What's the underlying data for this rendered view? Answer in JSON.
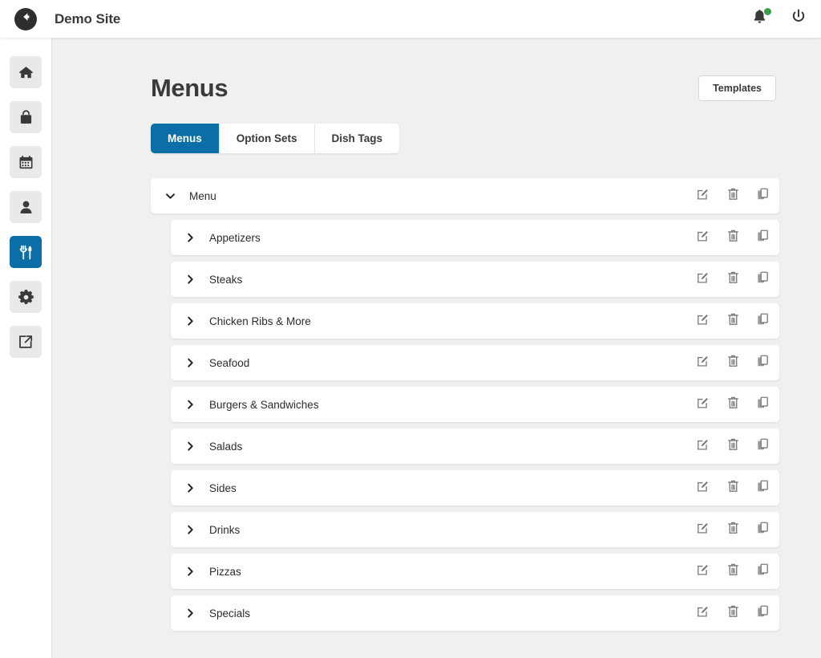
{
  "header": {
    "back_icon": "arrow-circle-left-icon",
    "site_title": "Demo Site",
    "notifications_icon": "bell-icon",
    "notification_badge": true,
    "power_icon": "power-icon"
  },
  "sidebar": {
    "items": [
      {
        "name": "home",
        "icon": "home-icon",
        "active": false
      },
      {
        "name": "orders",
        "icon": "shopping-bag-icon",
        "active": false
      },
      {
        "name": "bookings",
        "icon": "calendar-icon",
        "active": false
      },
      {
        "name": "customers",
        "icon": "user-icon",
        "active": false
      },
      {
        "name": "menus",
        "icon": "utensils-icon",
        "active": true
      },
      {
        "name": "settings",
        "icon": "gear-icon",
        "active": false
      },
      {
        "name": "open-site",
        "icon": "external-link-icon",
        "active": false
      }
    ]
  },
  "main": {
    "title": "Menus",
    "templates_button": "Templates",
    "tabs": [
      {
        "label": "Menus",
        "active": true
      },
      {
        "label": "Option Sets",
        "active": false
      },
      {
        "label": "Dish Tags",
        "active": false
      }
    ],
    "row_actions": {
      "edit": "edit-icon",
      "delete": "trash-icon",
      "duplicate": "copy-icon"
    },
    "rows": [
      {
        "label": "Menu",
        "level": 0,
        "expanded": true
      },
      {
        "label": "Appetizers",
        "level": 1,
        "expanded": false
      },
      {
        "label": "Steaks",
        "level": 1,
        "expanded": false
      },
      {
        "label": "Chicken Ribs & More",
        "level": 1,
        "expanded": false
      },
      {
        "label": "Seafood",
        "level": 1,
        "expanded": false
      },
      {
        "label": "Burgers & Sandwiches",
        "level": 1,
        "expanded": false
      },
      {
        "label": "Salads",
        "level": 1,
        "expanded": false
      },
      {
        "label": "Sides",
        "level": 1,
        "expanded": false
      },
      {
        "label": "Drinks",
        "level": 1,
        "expanded": false
      },
      {
        "label": "Pizzas",
        "level": 1,
        "expanded": false
      },
      {
        "label": "Specials",
        "level": 1,
        "expanded": false
      }
    ]
  },
  "colors": {
    "accent": "#0c6ea6",
    "page_background": "#f0f0f0",
    "surface": "#ffffff",
    "text": "#3a3a3a",
    "notification": "#3a9e4b"
  }
}
